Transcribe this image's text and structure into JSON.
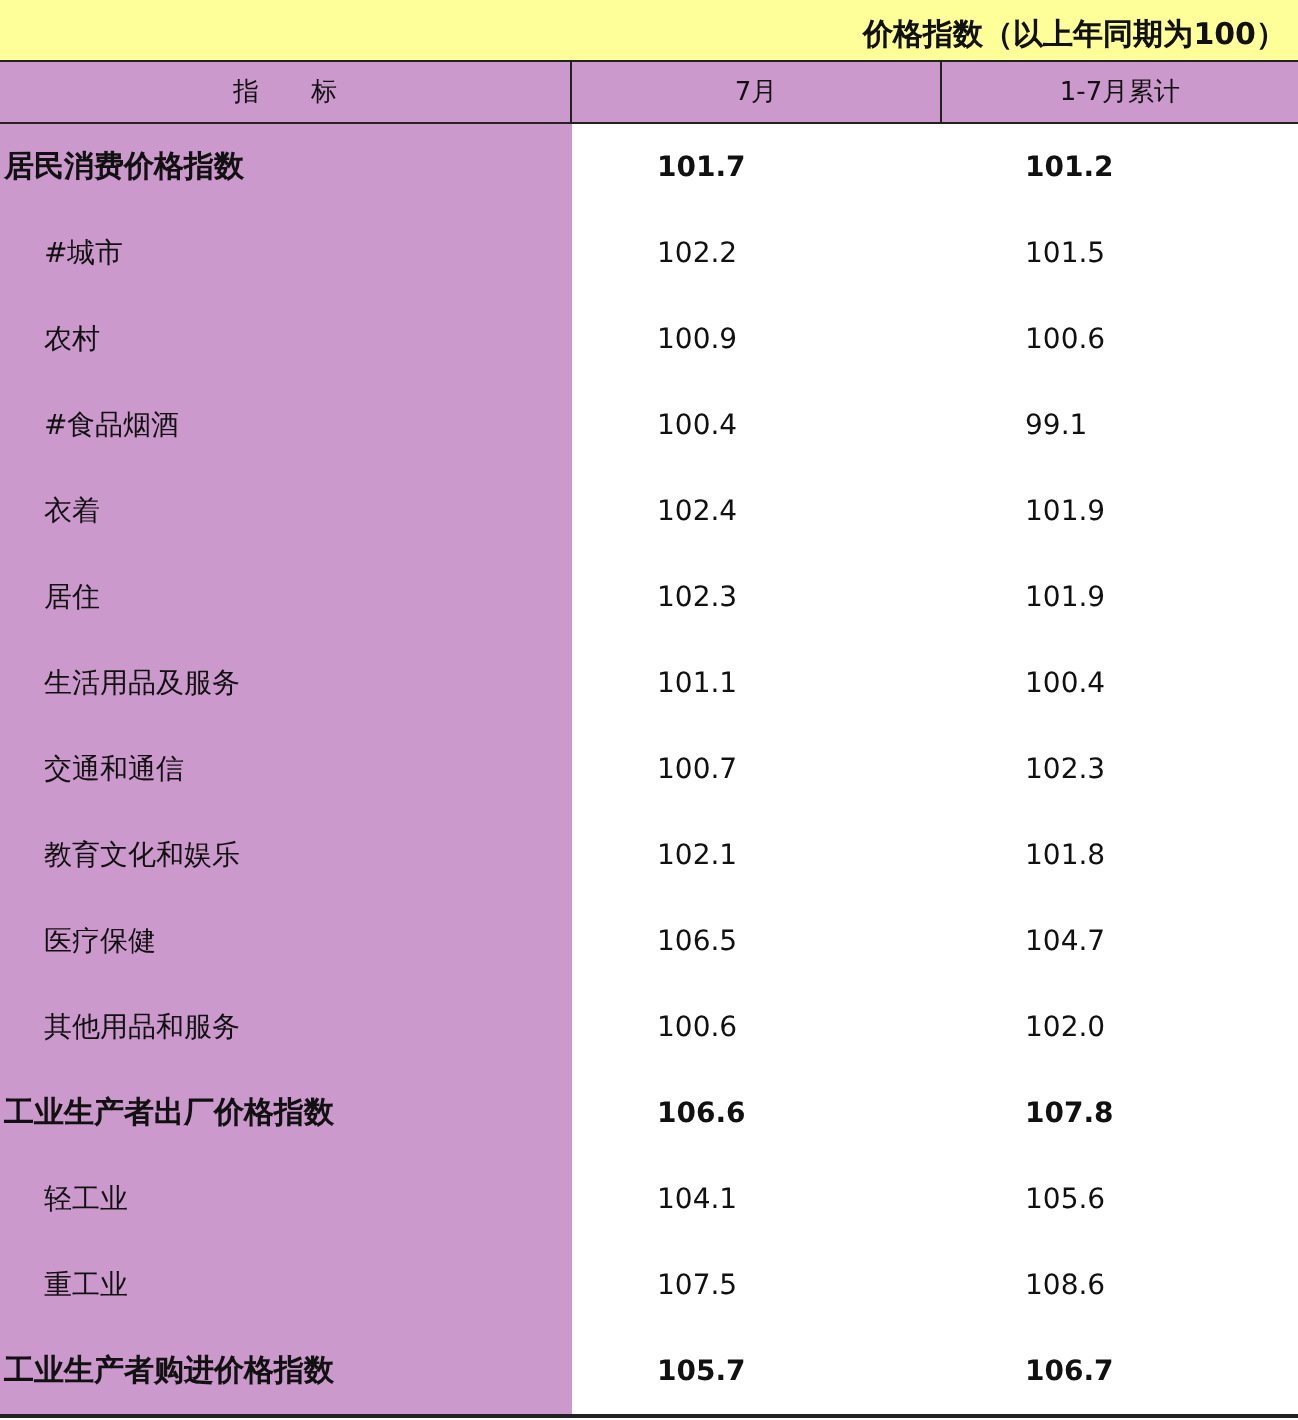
{
  "caption": "价格指数（以上年同期为100）",
  "columns": [
    "指　　标",
    "7月",
    "1-7月累计"
  ],
  "rows": [
    {
      "label": "居民消费价格指数",
      "values": [
        "101.7",
        "101.2"
      ],
      "children": [
        {
          "label": "#城市",
          "values": [
            "102.2",
            "101.5"
          ]
        },
        {
          "label": "农村",
          "values": [
            "100.9",
            "100.6"
          ]
        },
        {
          "label": "#食品烟酒",
          "values": [
            "100.4",
            "99.1"
          ]
        },
        {
          "label": "衣着",
          "values": [
            "102.4",
            "101.9"
          ]
        },
        {
          "label": "居住",
          "values": [
            "102.3",
            "101.9"
          ]
        },
        {
          "label": "生活用品及服务",
          "values": [
            "101.1",
            "100.4"
          ]
        },
        {
          "label": "交通和通信",
          "values": [
            "100.7",
            "102.3"
          ]
        },
        {
          "label": "教育文化和娱乐",
          "values": [
            "102.1",
            "101.8"
          ]
        },
        {
          "label": "医疗保健",
          "values": [
            "106.5",
            "104.7"
          ]
        },
        {
          "label": "其他用品和服务",
          "values": [
            "100.6",
            "102.0"
          ]
        }
      ]
    },
    {
      "label": "工业生产者出厂价格指数",
      "values": [
        "106.6",
        "107.8"
      ],
      "children": [
        {
          "label": "轻工业",
          "values": [
            "104.1",
            "105.6"
          ]
        },
        {
          "label": "重工业",
          "values": [
            "107.5",
            "108.6"
          ]
        }
      ]
    },
    {
      "label": "工业生产者购进价格指数",
      "values": [
        "105.7",
        "106.7"
      ]
    }
  ]
}
